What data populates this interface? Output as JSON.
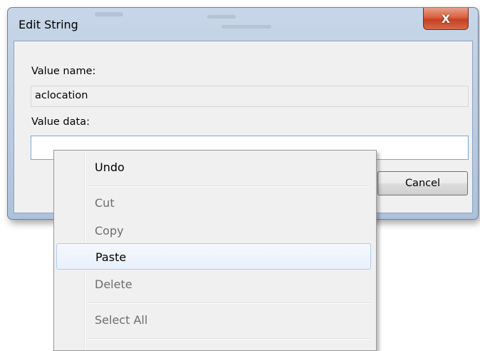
{
  "dialog": {
    "title": "Edit String",
    "close_glyph": "X",
    "value_name_label": "Value name:",
    "value_name": "aclocation",
    "value_data_label": "Value data:",
    "value_data": "",
    "cancel_label": "Cancel"
  },
  "context_menu": {
    "items": [
      {
        "label": "Undo",
        "enabled": true
      },
      {
        "label": "Cut",
        "enabled": false
      },
      {
        "label": "Copy",
        "enabled": false
      },
      {
        "label": "Paste",
        "enabled": true,
        "highlighted": true
      },
      {
        "label": "Delete",
        "enabled": false
      },
      {
        "label": "Select All",
        "enabled": false
      }
    ]
  },
  "colors": {
    "close_button": "#c7401d",
    "menu_highlight_border": "#aeccf0",
    "input_focus_border": "#7ea6d9"
  }
}
